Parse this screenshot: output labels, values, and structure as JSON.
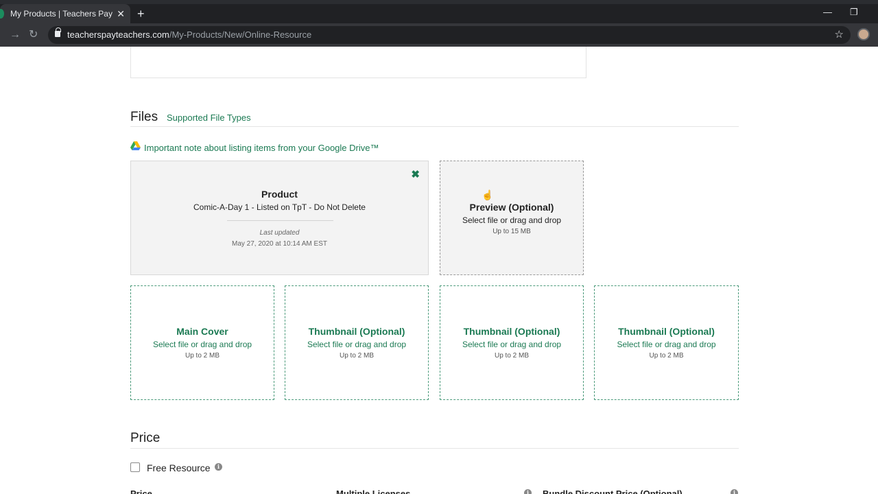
{
  "browser": {
    "tab_title": "My Products | Teachers Pay Teach",
    "tab_close": "✕",
    "new_tab": "+",
    "url_host": "teacherspayteachers.com",
    "url_path": "/My-Products/New/Online-Resource",
    "icons": [
      "back-icon",
      "forward-icon",
      "reload-icon",
      "lock-icon",
      "star-icon",
      "avatar"
    ]
  },
  "files": {
    "title": "Files",
    "supported_link": "Supported File Types",
    "gdrive_note": "Important note about listing items from your Google Drive™"
  },
  "product_card": {
    "title": "Product",
    "name": "Comic-A-Day 1 - Listed on TpT - Do Not Delete",
    "last_updated_label": "Last updated",
    "last_updated_date": "May 27, 2020 at 10:14 AM EST",
    "remove_icon": "✖"
  },
  "preview_card": {
    "title": "Preview (Optional)",
    "subtitle": "Select file or drag and drop",
    "limit": "Up to 15 MB"
  },
  "image_cards": [
    {
      "title": "Main Cover",
      "subtitle": "Select file or drag and drop",
      "limit": "Up to 2 MB"
    },
    {
      "title": "Thumbnail (Optional)",
      "subtitle": "Select file or drag and drop",
      "limit": "Up to 2 MB"
    },
    {
      "title": "Thumbnail (Optional)",
      "subtitle": "Select file or drag and drop",
      "limit": "Up to 2 MB"
    },
    {
      "title": "Thumbnail (Optional)",
      "subtitle": "Select file or drag and drop",
      "limit": "Up to 2 MB"
    }
  ],
  "price": {
    "title": "Price",
    "free_resource_label": "Free Resource",
    "info_glyph": "i",
    "col_price": "Price",
    "col_multiple": "Multiple Licenses",
    "col_bundle": "Bundle Discount Price (Optional)"
  },
  "colors": {
    "accent": "#1b7a53",
    "dark_chrome": "#202124",
    "card_bg": "#f3f3f3"
  }
}
